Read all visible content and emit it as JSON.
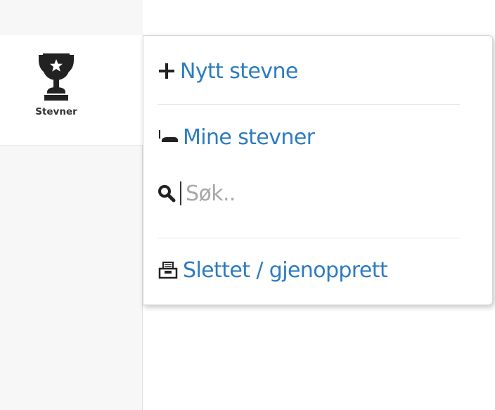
{
  "sidebar": {
    "nav": {
      "label": "Stevner",
      "icon": "trophy-icon"
    }
  },
  "menu": {
    "new_label": "Nytt stevne",
    "mine_label": "Mine stevner",
    "search_placeholder": "Søk..",
    "deleted_label": "Slettet / gjenopprett"
  },
  "colors": {
    "link": "#2d7bc0",
    "icon": "#222222",
    "text": "#333333"
  }
}
